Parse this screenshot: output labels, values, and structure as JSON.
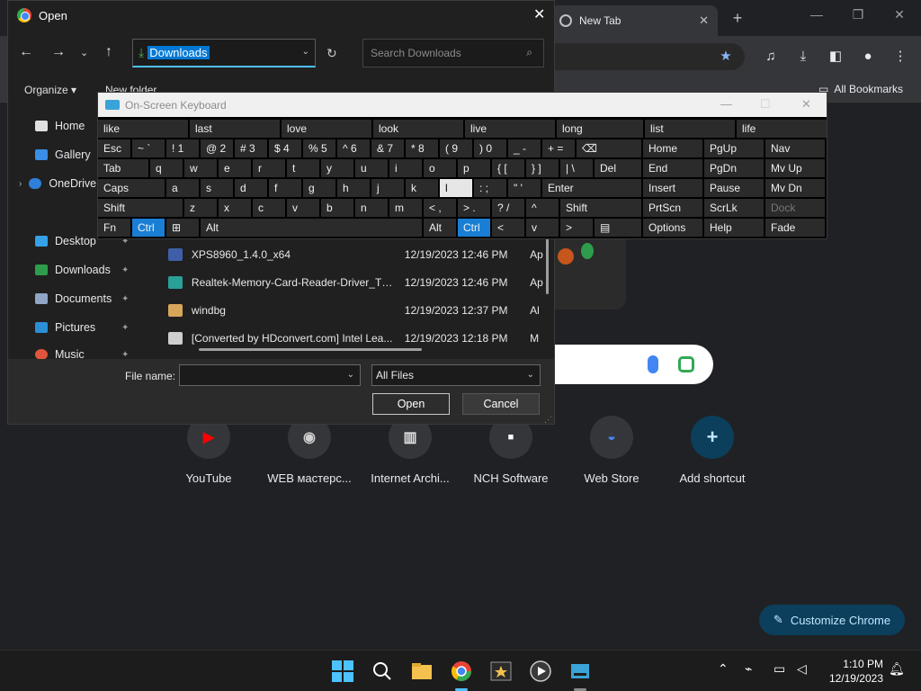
{
  "chrome": {
    "tab_title": "New Tab",
    "bookmarks_label": "All Bookmarks",
    "shortcuts": [
      {
        "label": "YouTube",
        "icon": "youtube-icon"
      },
      {
        "label": "WEB мастерс...",
        "icon": "eye-icon"
      },
      {
        "label": "Internet Archi...",
        "icon": "archive-icon"
      },
      {
        "label": "NCH Software",
        "icon": "nch-icon"
      },
      {
        "label": "Web Store",
        "icon": "webstore-icon"
      },
      {
        "label": "Add shortcut",
        "icon": "plus-icon"
      }
    ],
    "customize_label": "Customize Chrome"
  },
  "open_dialog": {
    "title": "Open",
    "path": "Downloads",
    "search_placeholder": "Search Downloads",
    "organize_label": "Organize ▾",
    "new_folder_label": "New folder",
    "sidebar": [
      {
        "label": "Home"
      },
      {
        "label": "Gallery"
      },
      {
        "label": "OneDrive"
      },
      {
        "label": "Desktop"
      },
      {
        "label": "Downloads"
      },
      {
        "label": "Documents"
      },
      {
        "label": "Pictures"
      },
      {
        "label": "Music"
      }
    ],
    "files": [
      {
        "name": "XPS8960_1.4.0_x64",
        "date": "12/19/2023 12:46 PM",
        "type": "Ap"
      },
      {
        "name": "Realtek-Memory-Card-Reader-Driver_T6...",
        "date": "12/19/2023 12:46 PM",
        "type": "Ap"
      },
      {
        "name": "windbg",
        "date": "12/19/2023 12:37 PM",
        "type": "Al"
      },
      {
        "name": "[Converted by HDconvert.com] Intel Lea...",
        "date": "12/19/2023 12:18 PM",
        "type": "M"
      }
    ],
    "file_name_label": "File name:",
    "file_name_value": "",
    "file_type": "All Files",
    "open_button": "Open",
    "cancel_button": "Cancel"
  },
  "osk": {
    "title": "On-Screen Keyboard",
    "predictions": [
      "like",
      "last",
      "love",
      "look",
      "live",
      "long",
      "list",
      "life"
    ],
    "row1": [
      "Esc",
      "~ `",
      "! 1",
      "@ 2",
      "# 3",
      "$ 4",
      "% 5",
      "^ 6",
      "& 7",
      "* 8",
      "( 9",
      ") 0",
      "_ -",
      "+ ="
    ],
    "row2": [
      "Tab",
      "q",
      "w",
      "e",
      "r",
      "t",
      "y",
      "u",
      "i",
      "o",
      "p",
      "{ [",
      "} ]",
      "| \\",
      "Del"
    ],
    "row3": [
      "Caps",
      "a",
      "s",
      "d",
      "f",
      "g",
      "h",
      "j",
      "k",
      "l",
      ": ;",
      "\" '",
      "Enter"
    ],
    "row4": [
      "Shift",
      "z",
      "x",
      "c",
      "v",
      "b",
      "n",
      "m",
      "< ,",
      "> .",
      "? /",
      "^",
      "Shift"
    ],
    "row5": [
      "Fn",
      "Ctrl",
      "⊞",
      "Alt",
      "Alt",
      "Ctrl",
      "<",
      "v",
      ">",
      "▤"
    ],
    "nav": [
      [
        "Home",
        "PgUp",
        "Nav"
      ],
      [
        "End",
        "PgDn",
        "Mv Up"
      ],
      [
        "Insert",
        "Pause",
        "Mv Dn"
      ],
      [
        "PrtScn",
        "ScrLk",
        "Dock"
      ],
      [
        "Options",
        "Help",
        "Fade"
      ]
    ]
  },
  "taskbar": {
    "time": "1:10 PM",
    "date": "12/19/2023"
  }
}
